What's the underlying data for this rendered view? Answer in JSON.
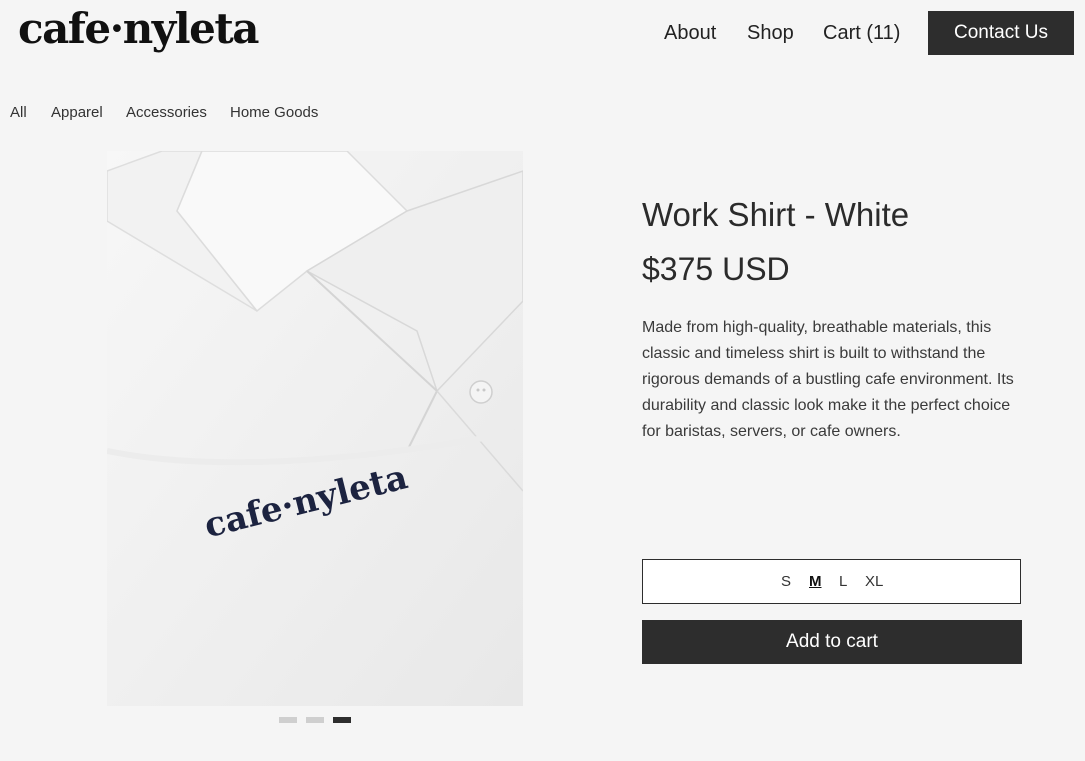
{
  "header": {
    "logo": "cafe·nyleta",
    "nav": [
      "About",
      "Shop",
      "Cart (11)"
    ],
    "contact_label": "Contact Us"
  },
  "categories": [
    "All",
    "Apparel",
    "Accessories",
    "Home Goods"
  ],
  "product": {
    "title": "Work Shirt - White",
    "price": "$375 USD",
    "description": "Made from high-quality, breathable materials, this classic and timeless shirt is built to withstand the rigorous demands of a bustling cafe environment. Its durability and classic look make it the perfect choice for baristas, servers, or cafe owners.",
    "image_embroidery": "cafe·nyleta",
    "sizes": [
      "S",
      "M",
      "L",
      "XL"
    ],
    "selected_size": "M",
    "add_to_cart_label": "Add to cart",
    "carousel": {
      "count": 3,
      "active": 3
    }
  }
}
